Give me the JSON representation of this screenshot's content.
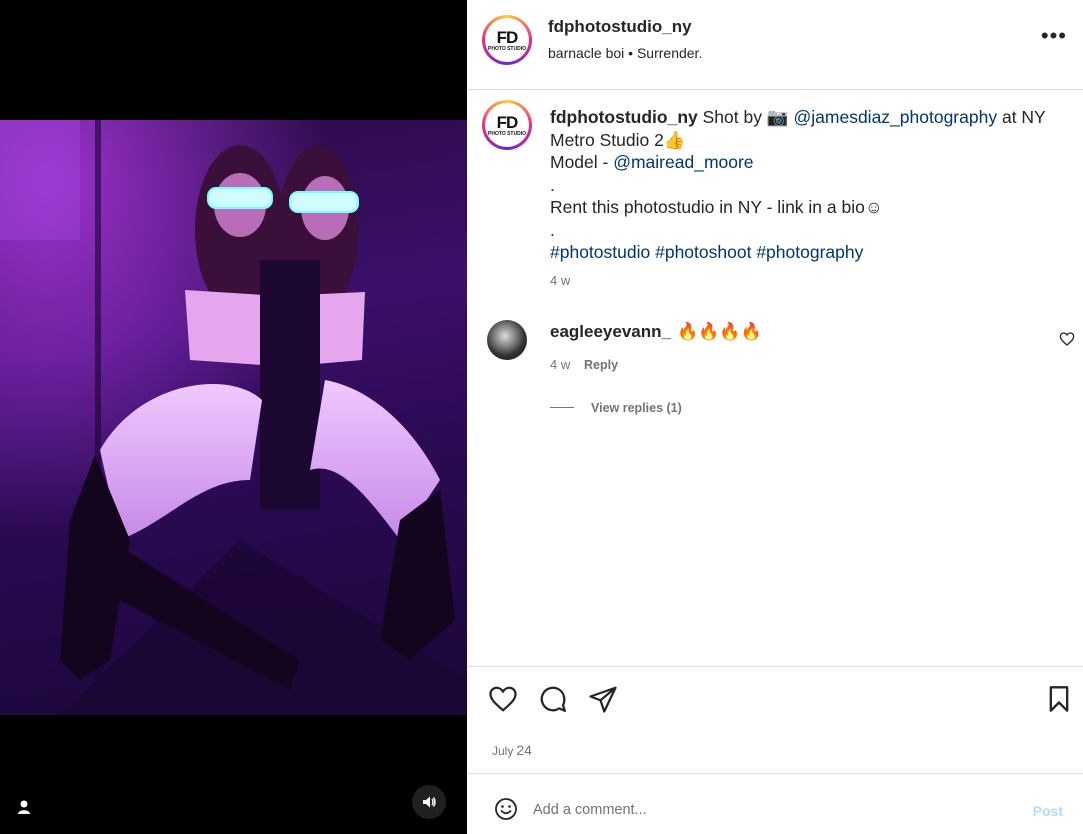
{
  "post": {
    "username": "fdphotostudio_ny",
    "audio": "barnacle boi • Surrender.",
    "more_label": "•••",
    "avatar_logo": "FD",
    "avatar_logo_sub": "PHOTO STUDIO"
  },
  "caption": {
    "username": "fdphotostudio_ny",
    "text1": " Shot by 📷  ",
    "mention1": "@jamesdiaz_photography",
    "text2": " at NY Metro Studio 2👍",
    "text3": "Model - ",
    "mention2": "@mairead_moore",
    "dot1": ".",
    "text4": "Rent this photostudio in NY - link in a bio☺",
    "dot2": ".",
    "hashtag1": "#photostudio",
    "hashtag2": "#photoshoot",
    "hashtag3": "#photography",
    "time": "4 w"
  },
  "comment": {
    "username": "eagleeyevann_",
    "text": "🔥🔥🔥🔥",
    "time": "4 w",
    "reply_label": "Reply",
    "view_replies": "View replies (1)"
  },
  "footer": {
    "date_month": "July",
    "date_day": "24",
    "comment_placeholder": "Add a comment...",
    "post_label": "Post"
  },
  "colors": {
    "link": "#00376b",
    "post_disabled": "#b3dbff",
    "divider": "#dbdbdb"
  }
}
